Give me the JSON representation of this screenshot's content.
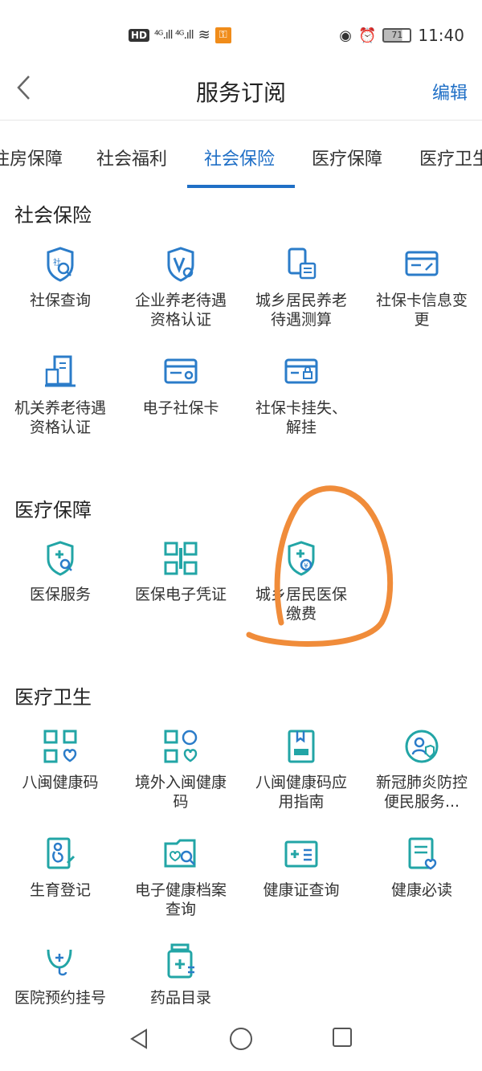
{
  "status_bar": {
    "hd": "HD",
    "network": "⁴ᴳ.ıll ⁴ᴳ.ıll",
    "battery": "71",
    "time": "11:40"
  },
  "header": {
    "back_icon": "chevron-left-icon",
    "title": "服务订阅",
    "edit_label": "编辑"
  },
  "tabs": [
    {
      "label": "住房保障"
    },
    {
      "label": "社会福利"
    },
    {
      "label": "社会保险",
      "active": true
    },
    {
      "label": "医疗保障"
    },
    {
      "label": "医疗卫生"
    }
  ],
  "sections": [
    {
      "title": "社会保险",
      "items": [
        {
          "label": "社保查询",
          "icon": "shield-search-icon"
        },
        {
          "label": "企业养老待遇资格认证",
          "icon": "shield-check-icon"
        },
        {
          "label": "城乡居民养老待遇测算",
          "icon": "calculator-doc-icon"
        },
        {
          "label": "社保卡信息变更",
          "icon": "card-edit-icon"
        },
        {
          "label": "机关养老待遇资格认证",
          "icon": "building-doc-icon"
        },
        {
          "label": "电子社保卡",
          "icon": "card-icon"
        },
        {
          "label": "社保卡挂失、解挂",
          "icon": "card-lock-icon"
        }
      ]
    },
    {
      "title": "医疗保障",
      "items": [
        {
          "label": "医保服务",
          "icon": "medical-shield-search-icon"
        },
        {
          "label": "医保电子凭证",
          "icon": "qr-code-icon"
        },
        {
          "label": "城乡居民医保缴费",
          "icon": "medical-shield-yuan-icon"
        }
      ]
    },
    {
      "title": "医疗卫生",
      "items": [
        {
          "label": "八闽健康码",
          "icon": "health-qr-icon"
        },
        {
          "label": "境外入闽健康码",
          "icon": "globe-qr-icon"
        },
        {
          "label": "八闽健康码应用指南",
          "icon": "guide-book-icon"
        },
        {
          "label": "新冠肺炎防控便民服务...",
          "icon": "person-shield-icon"
        },
        {
          "label": "生育登记",
          "icon": "pregnancy-doc-icon"
        },
        {
          "label": "电子健康档案查询",
          "icon": "health-file-search-icon"
        },
        {
          "label": "健康证查询",
          "icon": "health-card-icon"
        },
        {
          "label": "健康必读",
          "icon": "doc-heart-icon"
        },
        {
          "label": "医院预约挂号",
          "icon": "stethoscope-icon"
        },
        {
          "label": "药品目录",
          "icon": "medicine-bottle-icon"
        }
      ]
    }
  ],
  "nav": {
    "back_icon": "nav-back-icon",
    "home_icon": "nav-home-icon",
    "recent_icon": "nav-recent-icon"
  },
  "colors": {
    "accent": "#1f6fc6",
    "icon_blue": "#2b7cc9",
    "icon_teal": "#22a5a6",
    "annotation": "#f08c3a"
  }
}
